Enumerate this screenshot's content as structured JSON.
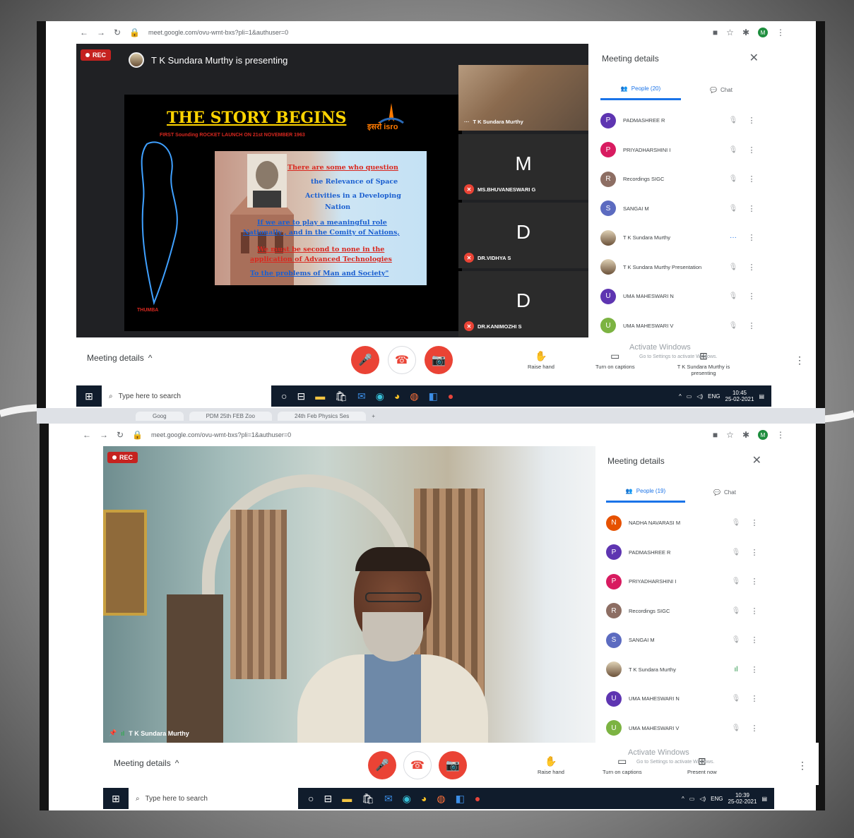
{
  "top": {
    "browser": {
      "url": "meet.google.com/ovu-wmt-bxs?pli=1&authuser=0"
    },
    "rec_label": "REC",
    "presenting_text": "T K Sundara Murthy is presenting",
    "slide": {
      "title": "THE STORY BEGINS",
      "subtitle": "FIRST Sounding ROCKET LAUNCH ON 21st NOVEMBER 1963",
      "logo_text": "इसरो isro",
      "lines": [
        "There are some who question",
        "the Relevance of Space",
        "Activities in a Developing",
        "Nation",
        "If we are to play a meaningful role",
        "Nationally , and in the Comity of Nations,",
        "We must be second to none in the",
        "application of Advanced Technologies",
        "To the problems of Man and Society\""
      ],
      "side_tag": "THUMBA"
    },
    "tiles": [
      {
        "name": "T K Sundara Murthy",
        "initial": "",
        "color": ""
      },
      {
        "name": "MS.BHUVANESWARI G",
        "initial": "M",
        "color": "#5c6bc0"
      },
      {
        "name": "DR.VIDHYA S",
        "initial": "D",
        "color": "#78909c"
      },
      {
        "name": "DR.KANIMOZHI S",
        "initial": "D",
        "color": "#5e35b1"
      }
    ],
    "panel": {
      "title": "Meeting details",
      "tab_people": "People (20)",
      "tab_chat": "Chat",
      "people": [
        {
          "initial": "P",
          "name": "PADMASHREE R",
          "color": "#5e35b1"
        },
        {
          "initial": "P",
          "name": "PRIYADHARSHINI I",
          "color": "#d81b60"
        },
        {
          "initial": "R",
          "name": "Recordings SIGC",
          "color": "#8d6e63"
        },
        {
          "initial": "S",
          "name": "SANGAI M",
          "color": "#5c6bc0"
        },
        {
          "initial": "",
          "name": "T K Sundara Murthy",
          "color": "#a1887f"
        },
        {
          "initial": "",
          "name": "T K Sundara Murthy Presentation",
          "color": "#a1887f"
        },
        {
          "initial": "U",
          "name": "UMA MAHESWARI N",
          "color": "#5e35b1"
        },
        {
          "initial": "U",
          "name": "UMA MAHESWARI V",
          "color": "#7cb342"
        }
      ]
    },
    "bar": {
      "meeting_details": "Meeting details",
      "raise_hand": "Raise hand",
      "captions": "Turn on captions",
      "presenting": "T K Sundara Murthy is presenting",
      "activate": "Activate Windows",
      "activate_sub": "Go to Settings to activate Windows."
    },
    "taskbar": {
      "search": "Type here to search",
      "lang": "ENG",
      "time": "10:45",
      "date": "25-02-2021"
    }
  },
  "tabstrip": [
    "Goog",
    "PDM 25th FEB Zoo",
    "24th Feb Physics Ses"
  ],
  "bottom": {
    "browser": {
      "url": "meet.google.com/ovu-wmt-bxs?pli=1&authuser=0"
    },
    "rec_label": "REC",
    "video_name": "T K Sundara Murthy",
    "panel": {
      "title": "Meeting details",
      "tab_people": "People (19)",
      "tab_chat": "Chat",
      "people": [
        {
          "initial": "N",
          "name": "NADHA NAVARASI M",
          "color": "#e65100"
        },
        {
          "initial": "P",
          "name": "PADMASHREE R",
          "color": "#5e35b1"
        },
        {
          "initial": "P",
          "name": "PRIYADHARSHINI I",
          "color": "#d81b60"
        },
        {
          "initial": "R",
          "name": "Recordings SIGC",
          "color": "#8d6e63"
        },
        {
          "initial": "S",
          "name": "SANGAI M",
          "color": "#5c6bc0"
        },
        {
          "initial": "",
          "name": "T K Sundara Murthy",
          "color": "#a1887f"
        },
        {
          "initial": "U",
          "name": "UMA MAHESWARI N",
          "color": "#5e35b1"
        },
        {
          "initial": "U",
          "name": "UMA MAHESWARI V",
          "color": "#7cb342"
        }
      ]
    },
    "bar": {
      "meeting_details": "Meeting details",
      "raise_hand": "Raise hand",
      "captions": "Turn on captions",
      "present_now": "Present now",
      "activate": "Activate Windows",
      "activate_sub": "Go to Settings to activate Windows."
    },
    "taskbar": {
      "search": "Type here to search",
      "lang": "ENG",
      "time": "10:39",
      "date": "25-02-2021"
    }
  }
}
